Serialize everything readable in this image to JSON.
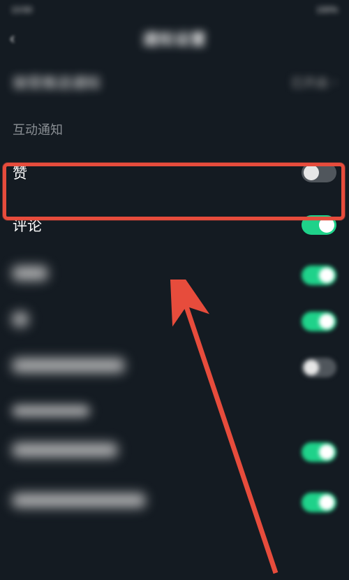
{
  "status": {
    "left": "13:50",
    "right": "100%"
  },
  "header": {
    "title": "通知设置"
  },
  "push": {
    "label": "接受推送通知",
    "value": "已开启"
  },
  "section1": {
    "title": "互动通知"
  },
  "rows": {
    "like": {
      "label": "赞"
    },
    "comment": {
      "label": "评论"
    },
    "r3": {
      "label": "粉丝"
    },
    "r4": {
      "label": "@"
    },
    "r5": {
      "label": "在线不推送通知"
    }
  },
  "section2": {
    "title": "私信消息通知"
  },
  "rows2": {
    "r6": {
      "label": "私信应用外通知"
    },
    "r7": {
      "label": "私信应用内横幅通知"
    }
  }
}
